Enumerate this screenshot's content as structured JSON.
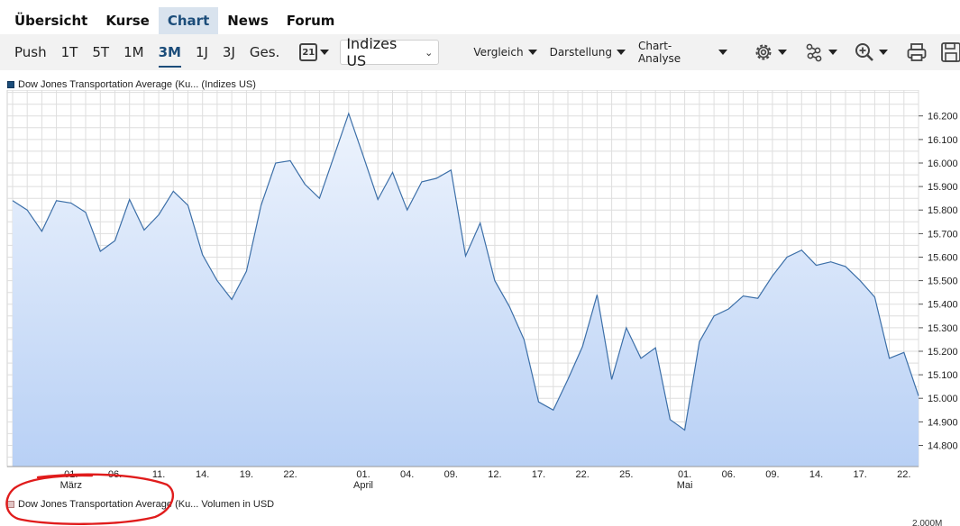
{
  "nav": {
    "tabs": [
      {
        "label": "Übersicht"
      },
      {
        "label": "Kurse"
      },
      {
        "label": "Chart"
      },
      {
        "label": "News"
      },
      {
        "label": "Forum"
      }
    ],
    "active_tab": "Chart"
  },
  "toolbar": {
    "ranges": [
      "Push",
      "1T",
      "5T",
      "1M",
      "3M",
      "1J",
      "3J",
      "Ges."
    ],
    "active_range": "3M",
    "calendar_day": "21",
    "exchange_select": "Indizes US",
    "menus": [
      "Vergleich",
      "Darstellung",
      "Chart-Analyse"
    ],
    "icons": [
      "gear-icon",
      "network-icon",
      "zoom-icon",
      "print-icon",
      "save-icon"
    ]
  },
  "legend_top": "Dow Jones Transportation Average (Ku... (Indizes US)",
  "legend_bottom": "Dow Jones Transportation Average (Ku... Volumen in USD",
  "bottom_partial_label": "2.000M",
  "colors": {
    "line": "#3c6fa8",
    "fill_top": "#eef4fd",
    "fill_bottom": "#b8d0f5",
    "grid": "#dedede",
    "nav_active_bg": "#d9e3ee",
    "accent": "#1c4d7a",
    "annotation": "#e01c1c"
  },
  "chart_data": {
    "type": "area",
    "series": [
      {
        "name": "Dow Jones Transportation Average (Ku... (Indizes US)",
        "values": [
          15840,
          15800,
          15710,
          15840,
          15830,
          15790,
          15625,
          15670,
          15845,
          15715,
          15780,
          15880,
          15820,
          15610,
          15500,
          15420,
          15540,
          15820,
          16000,
          16010,
          15910,
          15850,
          16030,
          16210,
          16030,
          15845,
          15960,
          15800,
          15920,
          15935,
          15970,
          15605,
          15745,
          15500,
          15390,
          15250,
          14985,
          14950,
          15080,
          15220,
          15440,
          15080,
          15300,
          15170,
          15215,
          14910,
          14865,
          15240,
          15350,
          15380,
          15435,
          15425,
          15520,
          15600,
          15630,
          15565,
          15580,
          15560,
          15500,
          15430,
          15170,
          15195,
          15010
        ]
      }
    ],
    "ylim": [
      14710,
      16310
    ],
    "yticks": [
      "14.800",
      "14.900",
      "15.000",
      "15.100",
      "15.200",
      "15.300",
      "15.400",
      "15.500",
      "15.600",
      "15.700",
      "15.800",
      "15.900",
      "16.000",
      "16.100",
      "16.200"
    ],
    "yvalues": [
      14800,
      14900,
      15000,
      15100,
      15200,
      15300,
      15400,
      15500,
      15600,
      15700,
      15800,
      15900,
      16000,
      16100,
      16200
    ],
    "xticks": [
      {
        "i": 4,
        "label": "01.",
        "sub": "März"
      },
      {
        "i": 7,
        "label": "06.",
        "sub": ""
      },
      {
        "i": 10,
        "label": "11.",
        "sub": ""
      },
      {
        "i": 13,
        "label": "14.",
        "sub": ""
      },
      {
        "i": 16,
        "label": "19.",
        "sub": ""
      },
      {
        "i": 19,
        "label": "22.",
        "sub": ""
      },
      {
        "i": 24,
        "label": "01.",
        "sub": "April"
      },
      {
        "i": 27,
        "label": "04.",
        "sub": ""
      },
      {
        "i": 30,
        "label": "09.",
        "sub": ""
      },
      {
        "i": 33,
        "label": "12.",
        "sub": ""
      },
      {
        "i": 36,
        "label": "17.",
        "sub": ""
      },
      {
        "i": 39,
        "label": "22.",
        "sub": ""
      },
      {
        "i": 42,
        "label": "25.",
        "sub": ""
      },
      {
        "i": 46,
        "label": "01.",
        "sub": "Mai"
      },
      {
        "i": 49,
        "label": "06.",
        "sub": ""
      },
      {
        "i": 52,
        "label": "09.",
        "sub": ""
      },
      {
        "i": 55,
        "label": "14.",
        "sub": ""
      },
      {
        "i": 58,
        "label": "17.",
        "sub": ""
      },
      {
        "i": 61,
        "label": "22.",
        "sub": ""
      }
    ],
    "grid": true,
    "legend_position": "top-left"
  }
}
